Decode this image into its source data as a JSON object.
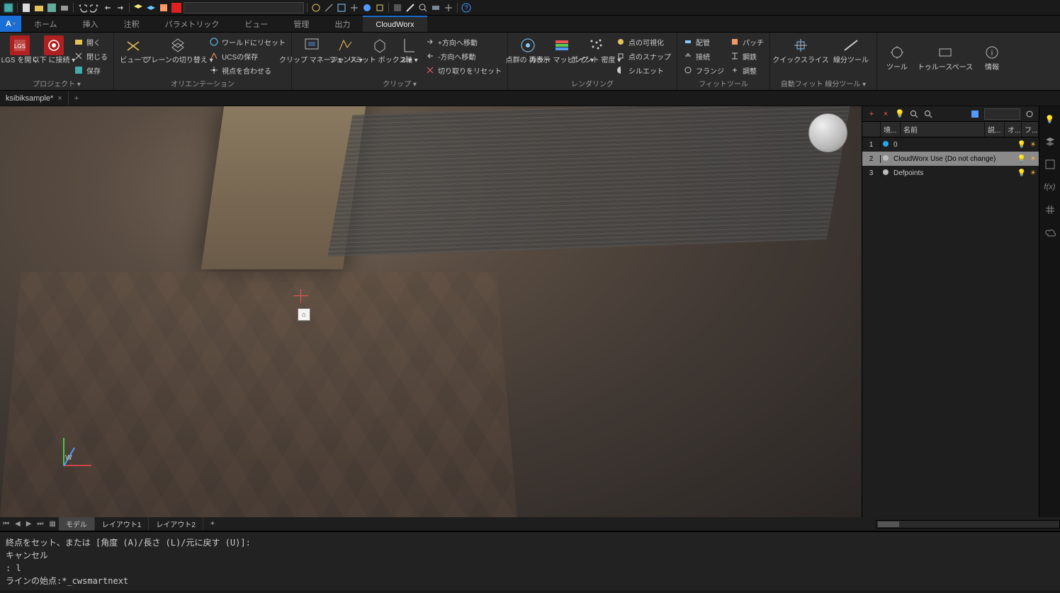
{
  "qat": {
    "swatch_color": "#e02020"
  },
  "menubar": {
    "tabs": [
      "ホーム",
      "挿入",
      "注釈",
      "パラメトリック",
      "ビュー",
      "管理",
      "出力",
      "CloudWorx"
    ],
    "active_index": 7,
    "app_letter": "A"
  },
  "ribbon": {
    "panels": {
      "project": {
        "title": "プロジェクト ▾",
        "lgs_open": "LGS\nを開く",
        "connect": "以下\nに接続 ▾",
        "small": {
          "open": "開く",
          "close": "閉じる",
          "save": "保存"
        }
      },
      "orientation": {
        "title": "オリエンテーション",
        "view": "ビューで",
        "plane": "プレーンの切り替え ▾",
        "small": {
          "world_reset": "ワールドにリセット",
          "ucs_save": "UCSの保存",
          "align_viewpoint": "視点を合わせる"
        }
      },
      "clip": {
        "title": "クリップ ▾",
        "clip_mgr": "クリップ\nマネージャ",
        "fence": "フェンス ▾",
        "limit_box": "リミット\nボックス ▾",
        "two_axis": "2軸 ▾",
        "small": {
          "move_plus": "+方向へ移動",
          "move_minus": "-方向へ移動",
          "cut_reset": "切り取りをリセット"
        }
      },
      "rendering": {
        "title": "レンダリング",
        "redisplay": "点群の\n再表示",
        "color_map": "カラー\nマッピング ▾",
        "density": "ポイント\n密度 ▾",
        "small": {
          "visualize": "点の可視化",
          "snap": "点のスナップ",
          "silhouette": "シルエット"
        }
      },
      "fit": {
        "title": "フィットツール",
        "col1": {
          "piping": "配管",
          "connect": "接続",
          "flange": "フランジ"
        },
        "col2": {
          "patch": "パッチ",
          "steel": "鋼鉄",
          "adjust": "調整"
        }
      },
      "autofit": {
        "title": "自動フィット 線分ツール ▾",
        "quickslice": "クイックスライス",
        "linetool": "線分ツール"
      },
      "tools": {
        "tools": "ツール",
        "truspace": "トゥルースペース",
        "info": "情報"
      }
    }
  },
  "doc_tab": {
    "name": "ksibiksample*"
  },
  "viewport": {
    "wcs_label": "W",
    "snap_glyph": "⌂"
  },
  "layers": {
    "header": {
      "state": "境...",
      "name": "名前",
      "desc": "説...",
      "on": "オ...",
      "freeze": "フ..."
    },
    "rows": [
      {
        "index": "1",
        "color": "#22aaee",
        "name": "0"
      },
      {
        "index": "2",
        "color": "#bbbbbb",
        "name": "CloudWorx Use (Do not change)"
      },
      {
        "index": "3",
        "color": "#bbbbbb",
        "name": "Defpoints"
      }
    ],
    "selected_index": 1
  },
  "layout_tabs": {
    "model": "モデル",
    "layout1": "レイアウト1",
    "layout2": "レイアウト2",
    "plus": "+"
  },
  "command": {
    "line0": "終点をセット、または [角度 (A)/長さ (L)/元に戻す (U)]:",
    "line1": "キャンセル",
    "line2": ": l",
    "line3": "ラインの始点:*_cwsmartnext"
  }
}
